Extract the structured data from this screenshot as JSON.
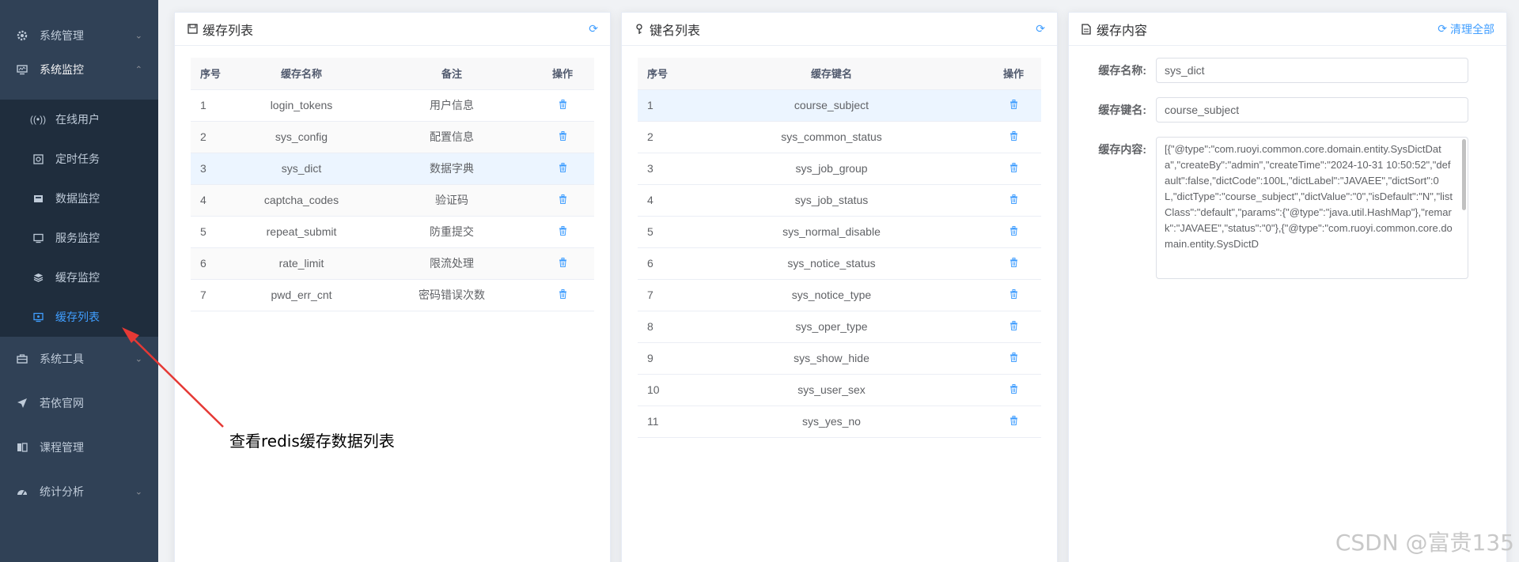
{
  "sidebar": {
    "menu_top": [
      {
        "label": "系统管理",
        "icon": "gear-icon"
      },
      {
        "label": "系统监控",
        "icon": "monitor-icon"
      }
    ],
    "sub_items": [
      {
        "label": "在线用户",
        "icon": "online-icon"
      },
      {
        "label": "定时任务",
        "icon": "job-icon"
      },
      {
        "label": "数据监控",
        "icon": "druid-icon"
      },
      {
        "label": "服务监控",
        "icon": "server-icon"
      },
      {
        "label": "缓存监控",
        "icon": "redis-icon"
      },
      {
        "label": "缓存列表",
        "icon": "redis-list-icon"
      }
    ],
    "menu_bottom": [
      {
        "label": "系统工具",
        "icon": "tool-icon"
      },
      {
        "label": "若依官网",
        "icon": "guide-icon"
      },
      {
        "label": "课程管理",
        "icon": "course-icon"
      },
      {
        "label": "统计分析",
        "icon": "stats-icon"
      }
    ]
  },
  "cache_list": {
    "title": "缓存列表",
    "columns": [
      "序号",
      "缓存名称",
      "备注",
      "操作"
    ],
    "rows": [
      {
        "no": "1",
        "name": "login_tokens",
        "remark": "用户信息"
      },
      {
        "no": "2",
        "name": "sys_config",
        "remark": "配置信息"
      },
      {
        "no": "3",
        "name": "sys_dict",
        "remark": "数据字典"
      },
      {
        "no": "4",
        "name": "captcha_codes",
        "remark": "验证码"
      },
      {
        "no": "5",
        "name": "repeat_submit",
        "remark": "防重提交"
      },
      {
        "no": "6",
        "name": "rate_limit",
        "remark": "限流处理"
      },
      {
        "no": "7",
        "name": "pwd_err_cnt",
        "remark": "密码错误次数"
      }
    ]
  },
  "key_list": {
    "title": "键名列表",
    "columns": [
      "序号",
      "缓存键名",
      "操作"
    ],
    "rows": [
      {
        "no": "1",
        "key": "course_subject"
      },
      {
        "no": "2",
        "key": "sys_common_status"
      },
      {
        "no": "3",
        "key": "sys_job_group"
      },
      {
        "no": "4",
        "key": "sys_job_status"
      },
      {
        "no": "5",
        "key": "sys_normal_disable"
      },
      {
        "no": "6",
        "key": "sys_notice_status"
      },
      {
        "no": "7",
        "key": "sys_notice_type"
      },
      {
        "no": "8",
        "key": "sys_oper_type"
      },
      {
        "no": "9",
        "key": "sys_show_hide"
      },
      {
        "no": "10",
        "key": "sys_user_sex"
      },
      {
        "no": "11",
        "key": "sys_yes_no"
      }
    ]
  },
  "cache_content": {
    "title": "缓存内容",
    "clear_all": "清理全部",
    "name_label": "缓存名称:",
    "name_value": "sys_dict",
    "key_label": "缓存键名:",
    "key_value": "course_subject",
    "content_label": "缓存内容:",
    "content_value": "[{\"@type\":\"com.ruoyi.common.core.domain.entity.SysDictData\",\"createBy\":\"admin\",\"createTime\":\"2024-10-31 10:50:52\",\"default\":false,\"dictCode\":100L,\"dictLabel\":\"JAVAEE\",\"dictSort\":0L,\"dictType\":\"course_subject\",\"dictValue\":\"0\",\"isDefault\":\"N\",\"listClass\":\"default\",\"params\":{\"@type\":\"java.util.HashMap\"},\"remark\":\"JAVAEE\",\"status\":\"0\"},{\"@type\":\"com.ruoyi.common.core.domain.entity.SysDictD"
  },
  "annotation": "查看redis缓存数据列表",
  "watermark": "CSDN @富贵135",
  "colors": {
    "sidebar_bg": "#304156",
    "submenu_bg": "#1f2d3d",
    "accent": "#409eff",
    "arrow_red": "#e53935"
  }
}
